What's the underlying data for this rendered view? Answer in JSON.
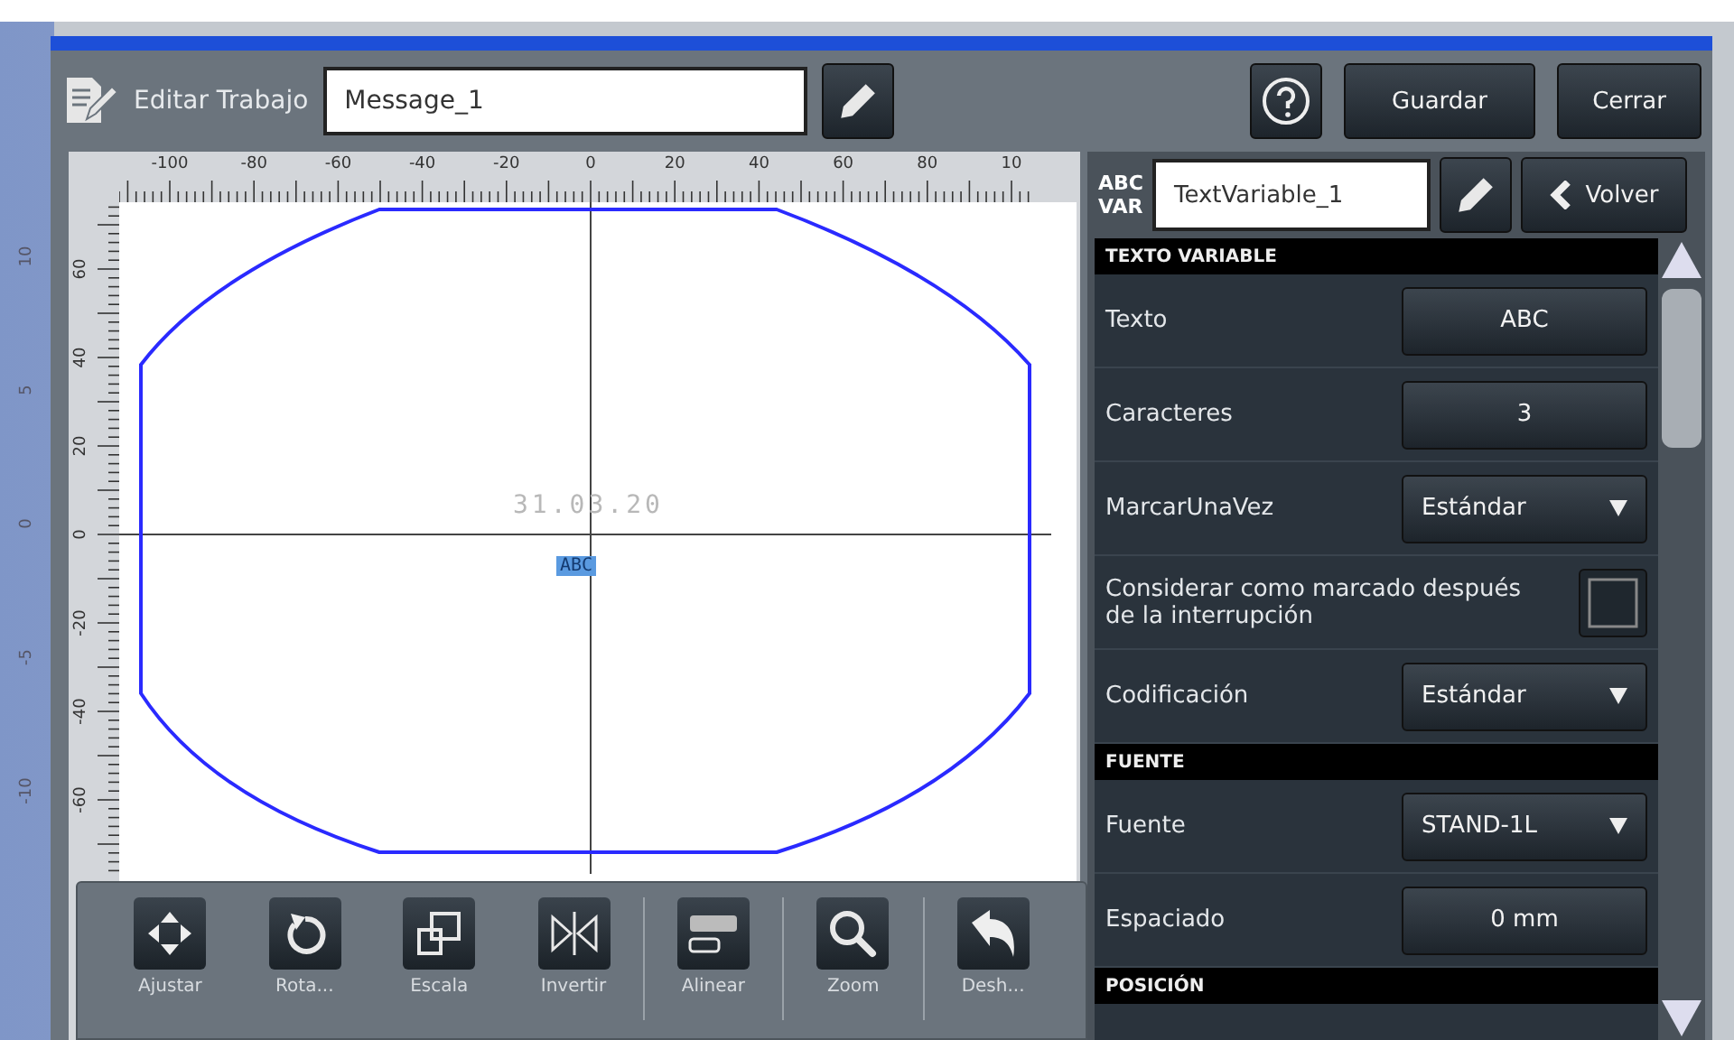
{
  "backdrop": {
    "ruler_labels": [
      "10",
      "5",
      "0",
      "-5",
      "-10"
    ]
  },
  "header": {
    "title": "Editar Trabajo",
    "job_name": "Message_1",
    "buttons": [
      "Guardar",
      "Cerrar"
    ]
  },
  "canvas": {
    "x_ticks": [
      "-100",
      "-80",
      "-60",
      "-40",
      "-20",
      "0",
      "20",
      "40",
      "60",
      "80",
      "10"
    ],
    "y_ticks": [
      "60",
      "40",
      "20",
      "0",
      "-20",
      "-40",
      "-60"
    ],
    "objects": [
      {
        "text": "31.03.20",
        "selected": false
      },
      {
        "text": "ABC",
        "selected": true
      }
    ]
  },
  "toolbar": [
    {
      "label": "Ajustar",
      "divider_before": false
    },
    {
      "label": "Rota...",
      "divider_before": false
    },
    {
      "label": "Escala",
      "divider_before": false
    },
    {
      "label": "Invertir",
      "divider_before": false
    },
    {
      "label": "Alinear",
      "divider_before": true
    },
    {
      "label": "Zoom",
      "divider_before": true
    },
    {
      "label": "Desh...",
      "divider_before": true
    }
  ],
  "properties": {
    "type_badge": [
      "ABC",
      "VAR"
    ],
    "name": "TextVariable_1",
    "back_button": "Volver",
    "rows": [
      {
        "kind": "section",
        "label": "TEXTO VARIABLE"
      },
      {
        "kind": "value",
        "label": "Texto",
        "value": "ABC"
      },
      {
        "kind": "value",
        "label": "Caracteres",
        "value": "3"
      },
      {
        "kind": "dropdown",
        "label": "MarcarUnaVez",
        "value": "Estándar"
      },
      {
        "kind": "checkbox",
        "label": "Considerar como marcado después de la interrupción",
        "checked": false
      },
      {
        "kind": "dropdown",
        "label": "Codificación",
        "value": "Estándar"
      },
      {
        "kind": "section",
        "label": "FUENTE"
      },
      {
        "kind": "dropdown",
        "label": "Fuente",
        "value": "STAND-1L"
      },
      {
        "kind": "value",
        "label": "Espaciado",
        "value": "0 mm"
      },
      {
        "kind": "section",
        "label": "POSICIÓN"
      }
    ]
  }
}
